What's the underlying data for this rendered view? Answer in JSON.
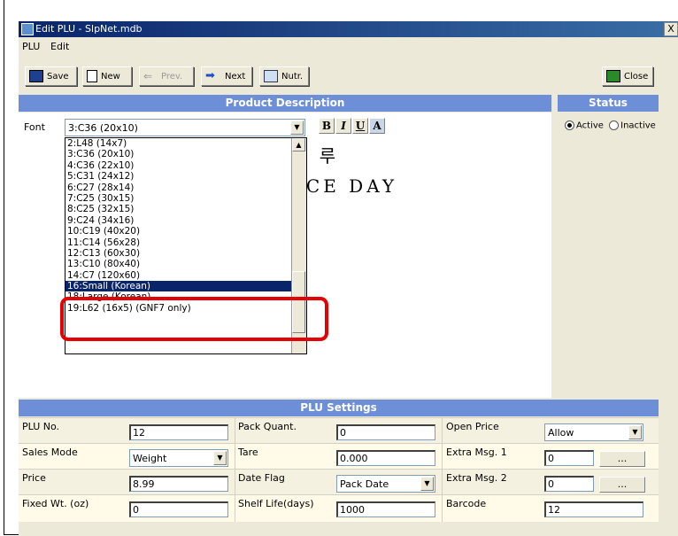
{
  "window": {
    "title": "Edit PLU - SlpNet.mdb",
    "close_label": "X"
  },
  "menu": {
    "items": [
      "PLU",
      "Edit"
    ]
  },
  "toolbar": {
    "save": "Save",
    "new": "New",
    "prev": "Prev.",
    "next": "Next",
    "nutr": "Nutr.",
    "close": "Close"
  },
  "product": {
    "header": "Product Description",
    "font_label": "Font",
    "font_value": "3:C36 (20x10)",
    "format_buttons": [
      "B",
      "I",
      "U",
      "A"
    ],
    "preview_line1": "하 루",
    "preview_line2": "ICE DAY",
    "font_options": [
      "2:L48 (14x7)",
      "3:C36 (20x10)",
      "4:C36 (22x10)",
      "5:C31 (24x12)",
      "6:C27 (28x14)",
      "7:C25 (30x15)",
      "8:C25 (32x15)",
      "9:C24 (34x16)",
      "10:C19 (40x20)",
      "11:C14 (56x28)",
      "12:C13 (60x30)",
      "13:C10 (80x40)",
      "14:C7 (120x60)",
      "16:Small (Korean)",
      "18:Large (Korean)",
      "19:L62 (16x5) (GNF7 only)"
    ],
    "selected_option": "16:Small (Korean)"
  },
  "status": {
    "header": "Status",
    "active": "Active",
    "inactive": "Inactive",
    "selected": "Active"
  },
  "settings": {
    "header": "PLU Settings",
    "rows": [
      {
        "l1": "PLU No.",
        "v1": "12",
        "l2": "Pack Quant.",
        "v2": "0",
        "l3": "Open Price",
        "v3": "Allow"
      },
      {
        "l1": "Sales Mode",
        "v1": "Weight",
        "l2": "Tare",
        "v2": "0.000",
        "l3": "Extra Msg. 1",
        "v3": "0",
        "b3": "..."
      },
      {
        "l1": "Price",
        "v1": "8.99",
        "l2": "Date Flag",
        "v2": "Pack Date",
        "l3": "Extra Msg. 2",
        "v3": "0",
        "b3": "..."
      },
      {
        "l1": "Fixed Wt. (oz)",
        "v1": "0",
        "l2": "Shelf Life(days)",
        "v2": "1000",
        "l3": "Barcode",
        "v3": "12"
      }
    ]
  }
}
